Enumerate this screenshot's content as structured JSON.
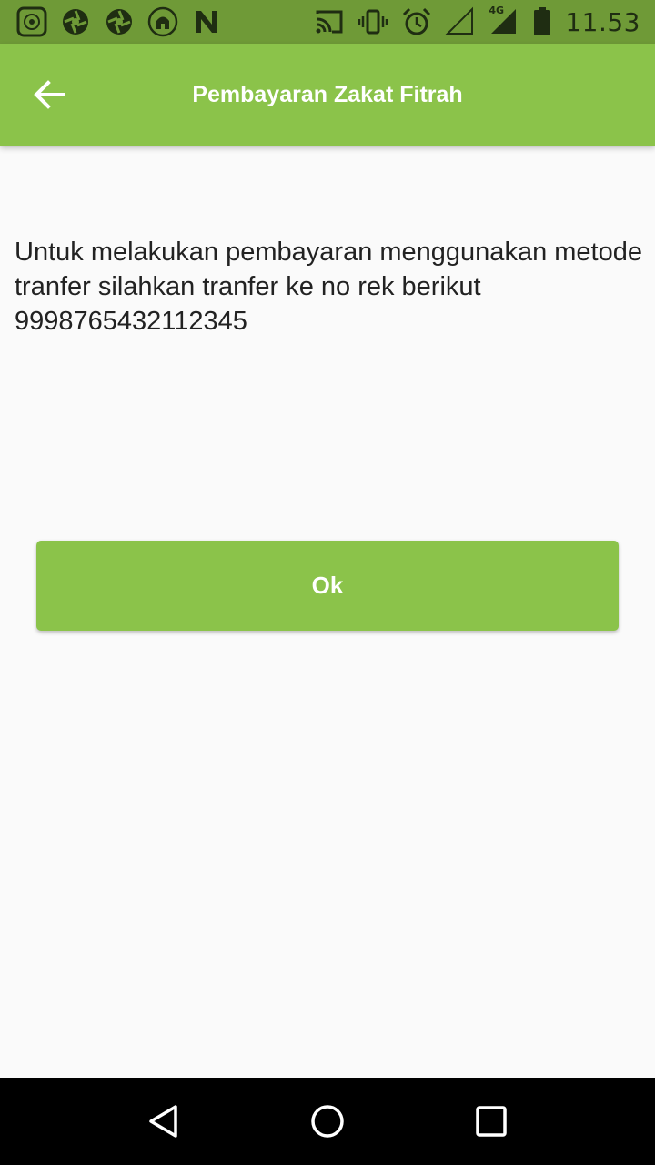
{
  "status_bar": {
    "time": "11.53",
    "network_label": "4G",
    "icons": [
      "islamic-app-icon",
      "aperture-icon",
      "aperture-icon",
      "mosque-app-icon",
      "n-app-icon",
      "cast-icon",
      "vibrate-icon",
      "alarm-icon",
      "signal-empty-icon",
      "signal-4g-icon",
      "battery-icon"
    ]
  },
  "app_bar": {
    "title": "Pembayaran Zakat Fitrah",
    "back_icon": "arrow-back-icon"
  },
  "main": {
    "message": "Untuk melakukan pembayaran menggunakan metode tranfer silahkan tranfer ke no rek berikut 9998765432112345",
    "ok_label": "Ok"
  },
  "nav_bar": {
    "icons": [
      "back-triangle-icon",
      "home-circle-icon",
      "recents-square-icon"
    ]
  },
  "colors": {
    "accent": "#8bc34a",
    "status_bar": "#6f9a37",
    "background": "#fafafa",
    "nav_bar": "#000000"
  }
}
